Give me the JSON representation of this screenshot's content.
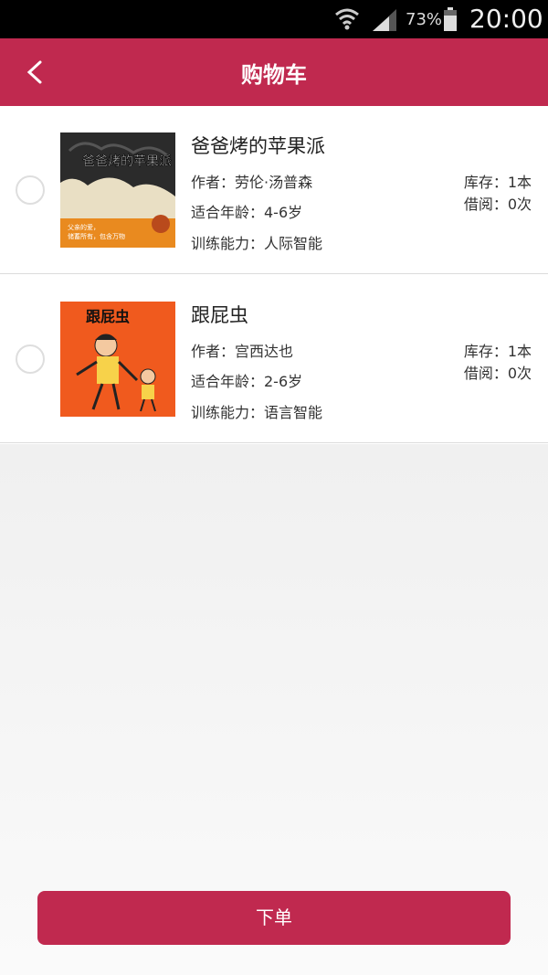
{
  "status_bar": {
    "battery_percent": "73%",
    "time": "20:00",
    "icons": [
      "wifi-icon",
      "signal-icon",
      "battery-icon"
    ]
  },
  "header": {
    "title": "购物车",
    "back_icon": "chevron-left-icon"
  },
  "cart_items": [
    {
      "title": "爸爸烤的苹果派",
      "author": "作者：劳伦·汤普森",
      "age": "适合年龄：4-6岁",
      "skill": "训练能力：人际智能",
      "stock": "库存：1本",
      "borrow": "借阅：0次",
      "cover": {
        "title_text": "爸爸烤的苹果派",
        "tagline_line1": "父亲的爱，",
        "tagline_line2": "储蓄所有，包含万物"
      }
    },
    {
      "title": "跟屁虫",
      "author": "作者：宫西达也",
      "age": "适合年龄：2-6岁",
      "skill": "训练能力：语言智能",
      "stock": "库存：1本",
      "borrow": "借阅：0次",
      "cover": {
        "title_text": "跟屁虫"
      }
    }
  ],
  "order_button": {
    "label": "下单"
  },
  "colors": {
    "brand": "#c0294f",
    "background": "#f2f2f2",
    "status_bar": "#000000"
  }
}
